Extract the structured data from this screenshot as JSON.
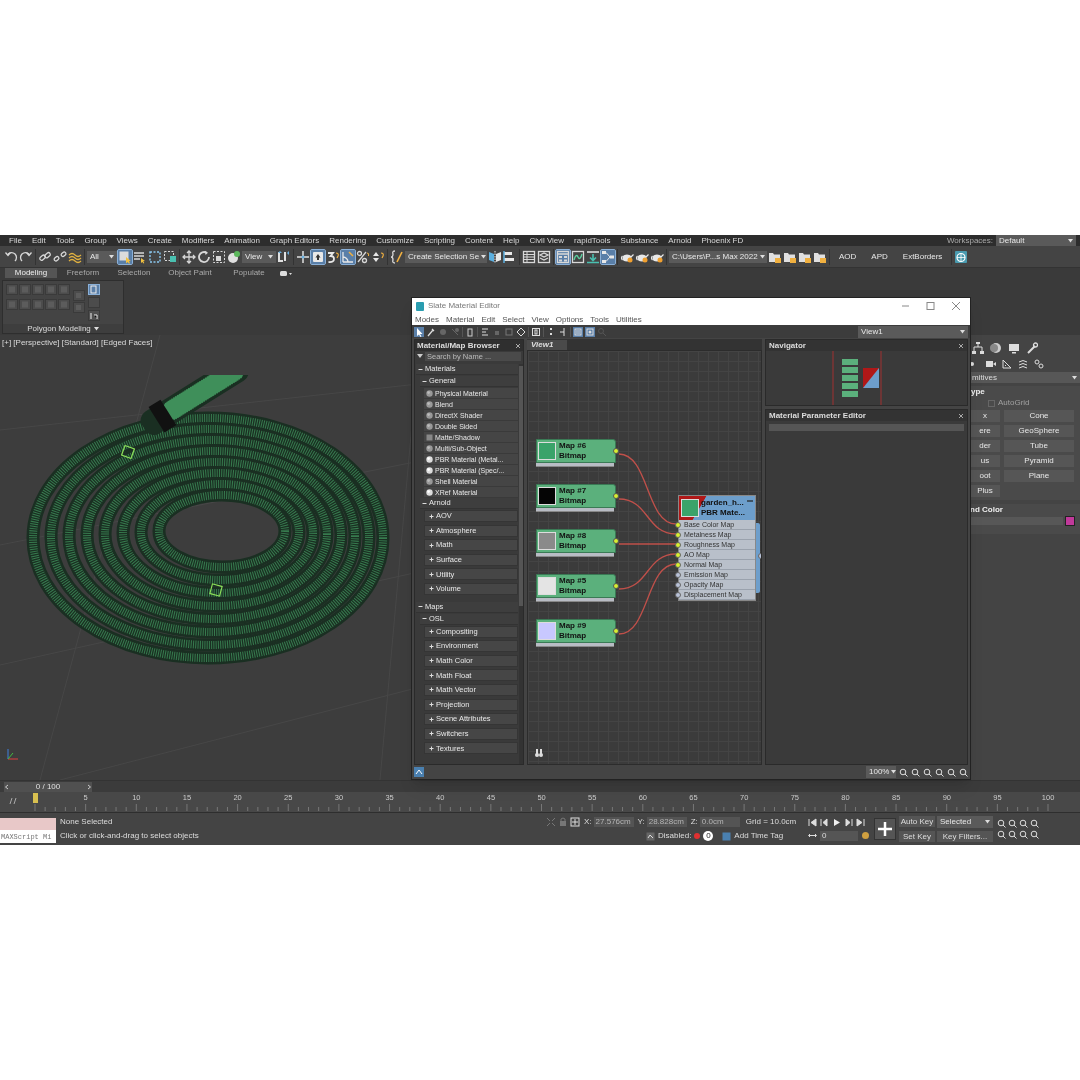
{
  "menu_bar": [
    "File",
    "Edit",
    "Tools",
    "Group",
    "Views",
    "Create",
    "Modifiers",
    "Animation",
    "Graph Editors",
    "Rendering",
    "Customize",
    "Scripting",
    "Content",
    "Help",
    "Civil View",
    "rapidTools",
    "Substance",
    "Arnold",
    "Phoenix FD"
  ],
  "workspaces": {
    "label": "Workspaces:",
    "value": "Default"
  },
  "main_toolbar": {
    "selection_filter": "All",
    "reference_coordinate": "View",
    "named_selection": "Create Selection Se",
    "project_folder": "C:\\Users\\P...s Max 2022",
    "text_buttons": [
      "AOD",
      "APD",
      "ExtBorders"
    ]
  },
  "ribbon": {
    "tabs": [
      {
        "label": "Modeling",
        "selected": true
      },
      {
        "label": "Freeform",
        "selected": false
      },
      {
        "label": "Selection",
        "selected": false
      },
      {
        "label": "Object Paint",
        "selected": false
      },
      {
        "label": "Populate",
        "selected": false
      }
    ],
    "panel_label": "Polygon Modeling"
  },
  "viewport": {
    "label": "[+] [Perspective] [Standard] [Edged Faces]"
  },
  "slate_editor": {
    "title": "Slate Material Editor",
    "menu": [
      "Modes",
      "Material",
      "Edit",
      "Select",
      "View",
      "Options",
      "Tools",
      "Utilities"
    ],
    "view_selector": "View1",
    "browser": {
      "title": "Material/Map Browser",
      "search_placeholder": "Search by Name ...",
      "tree": [
        {
          "label": "Materials",
          "expanded": true,
          "children": [
            {
              "label": "General",
              "expanded": true,
              "children": [
                {
                  "label": "Physical Material",
                  "kind": "sphere"
                },
                {
                  "label": "Blend",
                  "kind": "sphere"
                },
                {
                  "label": "DirectX Shader",
                  "kind": "sphere"
                },
                {
                  "label": "Double Sided",
                  "kind": "sphere"
                },
                {
                  "label": "Matte/Shadow",
                  "kind": "flat"
                },
                {
                  "label": "Multi/Sub-Object",
                  "kind": "sphere"
                },
                {
                  "label": "PBR Material (Metal...",
                  "kind": "glossy"
                },
                {
                  "label": "PBR Material (Spec/...",
                  "kind": "glossy"
                },
                {
                  "label": "Shell Material",
                  "kind": "sphere"
                },
                {
                  "label": "XRef Material",
                  "kind": "glossy"
                }
              ]
            },
            {
              "label": "Arnold",
              "expanded": true,
              "children": [
                {
                  "label": "AOV",
                  "expanded": false
                },
                {
                  "label": "Atmosphere",
                  "expanded": false
                },
                {
                  "label": "Math",
                  "expanded": false
                },
                {
                  "label": "Surface",
                  "expanded": false
                },
                {
                  "label": "Utility",
                  "expanded": false
                },
                {
                  "label": "Volume",
                  "expanded": false
                }
              ]
            }
          ]
        },
        {
          "label": "Maps",
          "expanded": true,
          "children": [
            {
              "label": "OSL",
              "expanded": true,
              "children": [
                {
                  "label": "Compositing",
                  "expanded": false
                },
                {
                  "label": "Environment",
                  "expanded": false
                },
                {
                  "label": "Math Color",
                  "expanded": false
                },
                {
                  "label": "Math Float",
                  "expanded": false
                },
                {
                  "label": "Math Vector",
                  "expanded": false
                },
                {
                  "label": "Projection",
                  "expanded": false
                },
                {
                  "label": "Scene Attributes",
                  "expanded": false
                },
                {
                  "label": "Switchers",
                  "expanded": false
                },
                {
                  "label": "Textures",
                  "expanded": false
                }
              ]
            }
          ]
        }
      ]
    },
    "view_tab": "View1",
    "map_nodes": [
      {
        "title": "Map #6",
        "type": "Bitmap",
        "color": "#3aa36a"
      },
      {
        "title": "Map #7",
        "type": "Bitmap",
        "color": "#050505"
      },
      {
        "title": "Map #8",
        "type": "Bitmap",
        "color": "#8a8a8a"
      },
      {
        "title": "Map #5",
        "type": "Bitmap",
        "color": "#e4e4e4"
      },
      {
        "title": "Map #9",
        "type": "Bitmap",
        "color": "#c8c8ff"
      }
    ],
    "material_node": {
      "title": "garden_h...",
      "type": "PBR Mate...",
      "slots": [
        {
          "label": "Base Color Map",
          "connected": true
        },
        {
          "label": "Metalness Map",
          "connected": true
        },
        {
          "label": "Roughness Map",
          "connected": true
        },
        {
          "label": "AO Map",
          "connected": true
        },
        {
          "label": "Normal Map",
          "connected": true
        },
        {
          "label": "Emission Map",
          "connected": false
        },
        {
          "label": "Opacity Map",
          "connected": false
        },
        {
          "label": "Displacement Map",
          "connected": false
        }
      ]
    },
    "navigator": {
      "title": "Navigator"
    },
    "parameter_editor": {
      "title": "Material Parameter Editor"
    },
    "zoom": "100%"
  },
  "command_panel": {
    "category": "mitives",
    "rollout_title": "ype",
    "autogrid": {
      "label": "AutoGrid",
      "checked": false,
      "disabled": true
    },
    "buttons": [
      "x",
      "Cone",
      "ere",
      "GeoSphere",
      "der",
      "Tube",
      "us",
      "Pyramid",
      "oot",
      "Plane",
      "Plus"
    ],
    "color_rollout_title": "nd Color"
  },
  "time_slider": {
    "position": "0 / 100"
  },
  "track_bar": {
    "ticks": [
      "5",
      "10",
      "15",
      "20",
      "25",
      "30",
      "35",
      "40",
      "45",
      "50",
      "55",
      "60",
      "65",
      "70",
      "75",
      "80",
      "85",
      "90",
      "95",
      "100"
    ]
  },
  "status_bar": {
    "maxscript_placeholder": "MAXScript Mi",
    "selection": "None Selected",
    "prompt": "Click or click-and-drag to select objects",
    "x_label": "X:",
    "x": "27.576cm",
    "y_label": "Y:",
    "y": "28.828cm",
    "z_label": "Z:",
    "z": "0.0cm",
    "grid": "Grid = 10.0cm",
    "disabled_label": "Disabled:",
    "time_tag_count": "0",
    "add_time_tag": "Add Time Tag",
    "auto_key": "Auto Key",
    "key_mode": "Selected",
    "set_key": "Set Key",
    "key_filters": "Key Filters...",
    "frame": "0"
  }
}
